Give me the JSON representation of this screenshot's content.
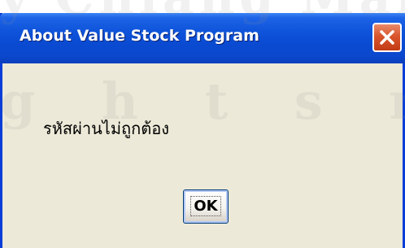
{
  "window": {
    "title": "About Value Stock Program"
  },
  "title_bar": {
    "close_icon": "close-icon"
  },
  "dialog": {
    "message": "รหัสผ่านไม่ถูกต้อง",
    "ok_label": "OK"
  },
  "watermark": {
    "line1": "y Chiang Mai",
    "line2": "g h t s r e s"
  },
  "colors": {
    "title_bar": "#0a4bd2",
    "frame": "#0a3dd8",
    "dialog_background": "#ece9d8",
    "close_button": "#d9552c"
  }
}
